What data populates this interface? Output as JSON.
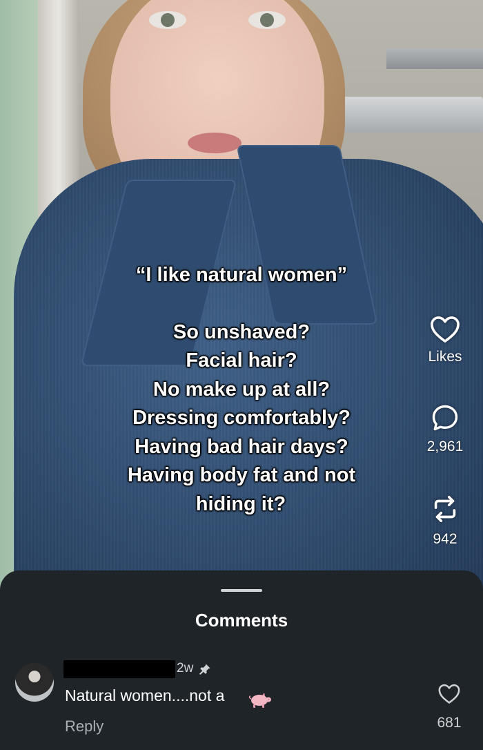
{
  "post": {
    "overlay_lines": [
      "“I like natural women”",
      "So unshaved?",
      "Facial hair?",
      "No make up at all?",
      "Dressing comfortably?",
      "Having bad hair days?",
      "Having body fat and not",
      "hiding it?"
    ]
  },
  "actions": {
    "likes_label": "Likes",
    "comments_count": "2,961",
    "reposts_count": "942"
  },
  "comments": {
    "title": "Comments",
    "items": [
      {
        "time": "2w",
        "text": "Natural women....not a",
        "reply_label": "Reply",
        "like_count": "681",
        "emoji": "pig-icon",
        "pinned": true
      }
    ]
  },
  "colors": {
    "sheet_bg": "#1f2429",
    "text_primary": "#ffffff",
    "text_secondary": "#aab0b5"
  }
}
